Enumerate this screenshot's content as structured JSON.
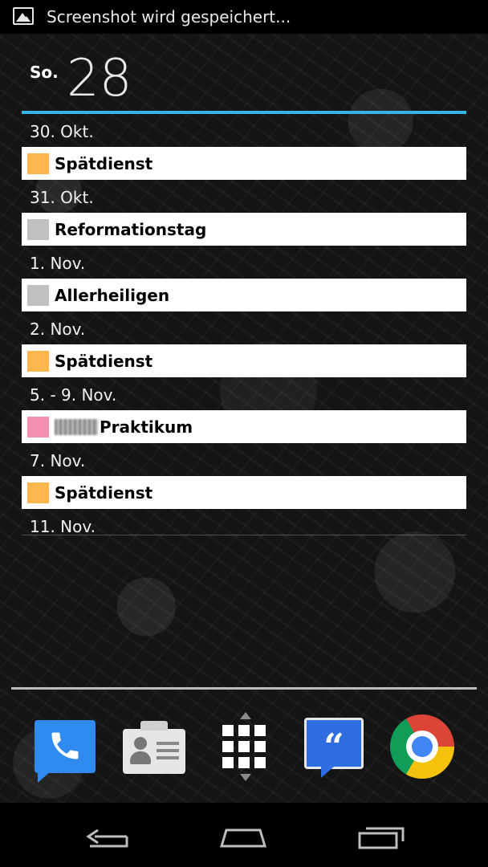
{
  "status_bar": {
    "notification_icon": "image-icon",
    "notification_text": "Screenshot wird gespeichert..."
  },
  "widget": {
    "weekday": "So.",
    "day_number": "28",
    "accent_color": "#33b5e5",
    "agenda": [
      {
        "date": "30. Okt.",
        "event": "Spätdienst",
        "color": "#ffb74d",
        "redacted": false
      },
      {
        "date": "31. Okt.",
        "event": "Reformationstag",
        "color": "#c0c0c0",
        "redacted": false
      },
      {
        "date": "1. Nov.",
        "event": "Allerheiligen",
        "color": "#c0c0c0",
        "redacted": false
      },
      {
        "date": "2. Nov.",
        "event": "Spätdienst",
        "color": "#ffb74d",
        "redacted": false
      },
      {
        "date": "5. - 9. Nov.",
        "event": "Praktikum",
        "color": "#f48fb1",
        "redacted": true
      },
      {
        "date": "7. Nov.",
        "event": "Spätdienst",
        "color": "#ffb74d",
        "redacted": false
      },
      {
        "date": "11. Nov."
      }
    ]
  },
  "dock": {
    "apps": [
      "phone-icon",
      "contacts-icon",
      "app-drawer-icon",
      "hangouts-icon",
      "chrome-icon"
    ]
  },
  "nav_bar": {
    "buttons": [
      "back-icon",
      "home-icon",
      "recent-apps-icon"
    ]
  }
}
